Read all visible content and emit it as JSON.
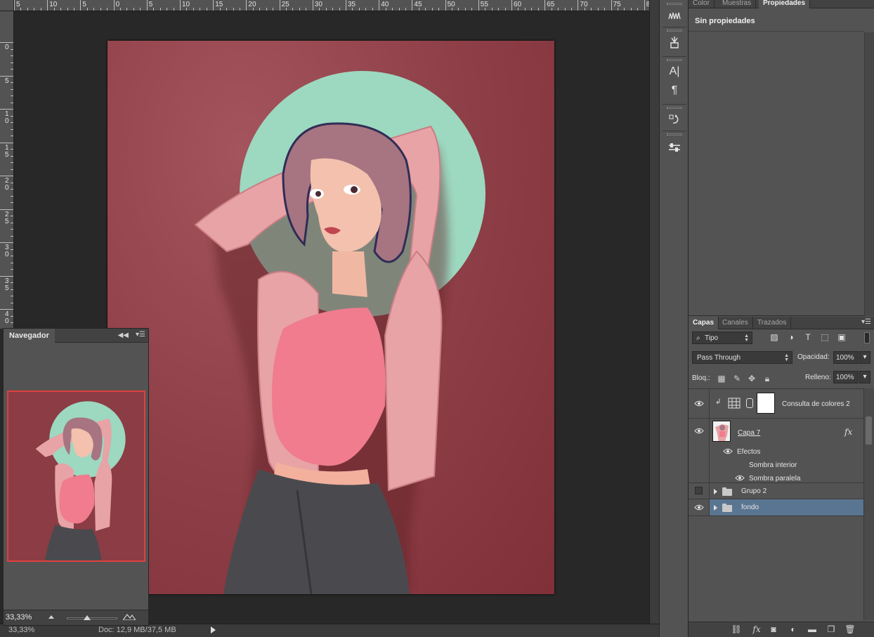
{
  "ruler_top": {
    "labels": [
      "5",
      "10",
      "5",
      "0",
      "5",
      "10",
      "15",
      "20",
      "25",
      "30",
      "35",
      "40",
      "45",
      "50",
      "55",
      "60",
      "65",
      "70",
      "75",
      "80"
    ]
  },
  "ruler_left": {
    "labels": [
      "0",
      "5",
      "10",
      "15",
      "20",
      "25",
      "30",
      "35",
      "40"
    ]
  },
  "statusbar": {
    "zoom": "33,33%",
    "doc_info": "Doc: 12,9 MB/37,5 MB"
  },
  "navigator": {
    "title": "Navegador",
    "zoom": "33,33%"
  },
  "properties_panel": {
    "tabs": [
      "Color",
      "Muestras",
      "Propiedades"
    ],
    "active_tab": "Propiedades",
    "body_text": "Sin propiedades"
  },
  "layers_panel": {
    "tabs": [
      "Capas",
      "Canales",
      "Trazados"
    ],
    "active_tab": "Capas",
    "filter_label": "Tipo",
    "blend_mode": "Pass Through",
    "opacity_label": "Opacidad:",
    "opacity_value": "100%",
    "lock_label": "Bloq.:",
    "fill_label": "Relleno:",
    "fill_value": "100%",
    "layers": [
      {
        "name": "Consulta de colores 2",
        "visible": true,
        "type": "adjustment"
      },
      {
        "name": "Capa 7",
        "visible": true,
        "type": "pixel",
        "has_fx": true
      },
      {
        "name": "Efectos",
        "visible": true,
        "type": "effects-header"
      },
      {
        "name": "Sombra interior",
        "visible": false,
        "type": "effect"
      },
      {
        "name": "Sombra paralela",
        "visible": true,
        "type": "effect"
      },
      {
        "name": "Grupo 2",
        "visible": false,
        "type": "group"
      },
      {
        "name": "fondo",
        "visible": true,
        "type": "group",
        "selected": true
      }
    ],
    "fx_label": "fx"
  },
  "colors": {
    "document_bg": "#8b3c44",
    "circle": "#9dd8c0",
    "selected_layer": "#5a7591",
    "nav_frame": "#e04040"
  }
}
